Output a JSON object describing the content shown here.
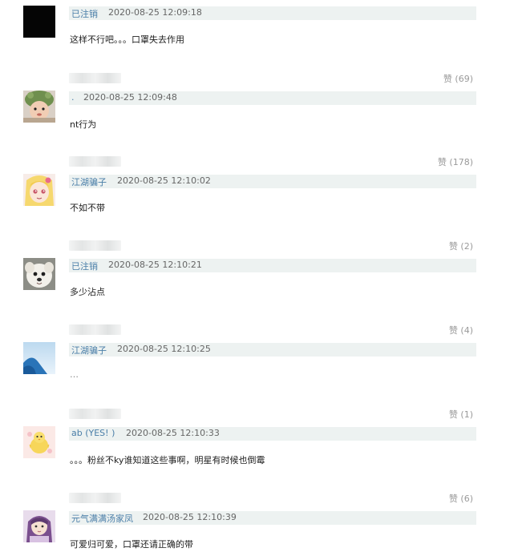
{
  "comments": [
    {
      "user": "已注销",
      "time": "2020-08-25 12:09:18",
      "text": "这样不行吧。。。口罩失去作用",
      "likes": "赞 (69)",
      "avatar": "black-square"
    },
    {
      "user": ".",
      "time": "2020-08-25 12:09:48",
      "text": "nt行为",
      "likes": "赞 (178)",
      "avatar": "baby-frog-hat"
    },
    {
      "user": "江湖骗子",
      "time": "2020-08-25 12:10:02",
      "text": "不如不带",
      "likes": "赞 (2)",
      "avatar": "anime-girl"
    },
    {
      "user": "已注销",
      "time": "2020-08-25 12:10:21",
      "text": "多少沾点",
      "likes": "赞 (4)",
      "avatar": "white-puppy"
    },
    {
      "user": "江湖骗子",
      "time": "2020-08-25 12:10:25",
      "text": "…",
      "likes": "赞 (1)",
      "avatar": "blue-sky"
    },
    {
      "user": "ab (YES! )",
      "time": "2020-08-25 12:10:33",
      "text": "。。。粉丝不ky谁知道这些事啊，明星有时候也倒霉",
      "likes": "赞 (6)",
      "avatar": "yellow-chick"
    },
    {
      "user": "元气满满汤家凤",
      "time": "2020-08-25 12:10:39",
      "text": "可爱归可爱，口罩还请正确的带",
      "likes": "",
      "avatar": "cartoon-girl-purple"
    }
  ]
}
